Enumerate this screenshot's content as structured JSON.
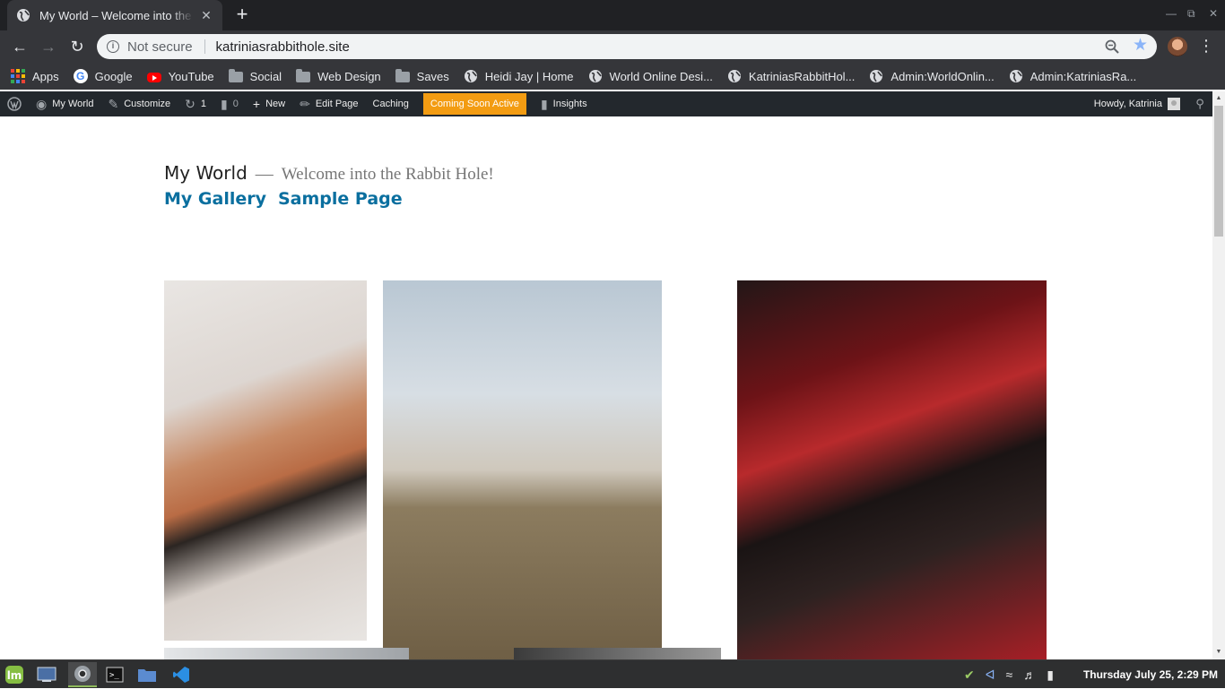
{
  "browser": {
    "tab_title": "My World – Welcome into the Rabbit Hole!",
    "tab_close": "✕",
    "new_tab": "+",
    "omnibox": {
      "security_label": "Not secure",
      "url": "katriniasrabbithole.site"
    },
    "bookmarks": [
      {
        "label": "Apps",
        "icon": "apps-grid-icon"
      },
      {
        "label": "Google",
        "icon": "google-icon"
      },
      {
        "label": "YouTube",
        "icon": "youtube-icon"
      },
      {
        "label": "Social",
        "icon": "folder-icon"
      },
      {
        "label": "Web Design",
        "icon": "folder-icon"
      },
      {
        "label": "Saves",
        "icon": "folder-icon"
      },
      {
        "label": "Heidi Jay | Home",
        "icon": "globe-icon"
      },
      {
        "label": "World Online Desi...",
        "icon": "globe-icon"
      },
      {
        "label": "KatriniasRabbitHol...",
        "icon": "globe-icon"
      },
      {
        "label": "Admin:WorldOnlin...",
        "icon": "globe-icon"
      },
      {
        "label": "Admin:KatriniasRa...",
        "icon": "globe-icon"
      }
    ]
  },
  "admin_bar": {
    "site_name": "My World",
    "customize": "Customize",
    "updates_count": "1",
    "comments_count": "0",
    "new": "New",
    "edit_page": "Edit Page",
    "caching": "Caching",
    "coming_soon": "Coming Soon Active",
    "insights": "Insights",
    "howdy": "Howdy, Katrinia",
    "colors": {
      "background": "#23282d",
      "coming_soon": "#f39c12"
    }
  },
  "site": {
    "title": "My World",
    "separator": "—",
    "description": "Welcome into the Rabbit Hole!",
    "menu": [
      "My Gallery",
      "Sample Page"
    ],
    "link_color": "#0a6f9f"
  },
  "taskbar": {
    "clock": "Thursday July 25,  2:29 PM",
    "apps": [
      "mint-menu-icon",
      "show-desktop-icon",
      "chrome-icon",
      "terminal-icon",
      "files-icon",
      "vscode-icon"
    ]
  }
}
